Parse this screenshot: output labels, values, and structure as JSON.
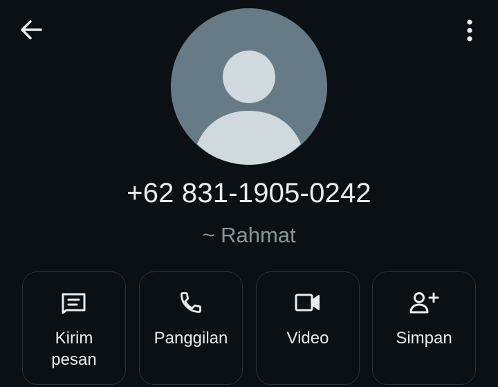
{
  "header": {
    "back_icon": "arrow-left-icon",
    "menu_icon": "more-vertical-icon"
  },
  "contact": {
    "avatar_icon": "default-person-avatar",
    "phone": "+62 831-1905-0242",
    "name": "~ Rahmat"
  },
  "actions": [
    {
      "id": "message",
      "icon": "message-icon",
      "label": "Kirim\npesan"
    },
    {
      "id": "call",
      "icon": "phone-icon",
      "label": "Panggilan"
    },
    {
      "id": "video",
      "icon": "video-camera-icon",
      "label": "Video"
    },
    {
      "id": "save",
      "icon": "add-person-icon",
      "label": "Simpan"
    }
  ],
  "colors": {
    "background": "#0b1014",
    "avatar_bg": "#667b86",
    "avatar_fg": "#cfd9de",
    "text_primary": "#e9edef",
    "text_secondary": "#8a969c",
    "button_border": "#2b3338"
  }
}
